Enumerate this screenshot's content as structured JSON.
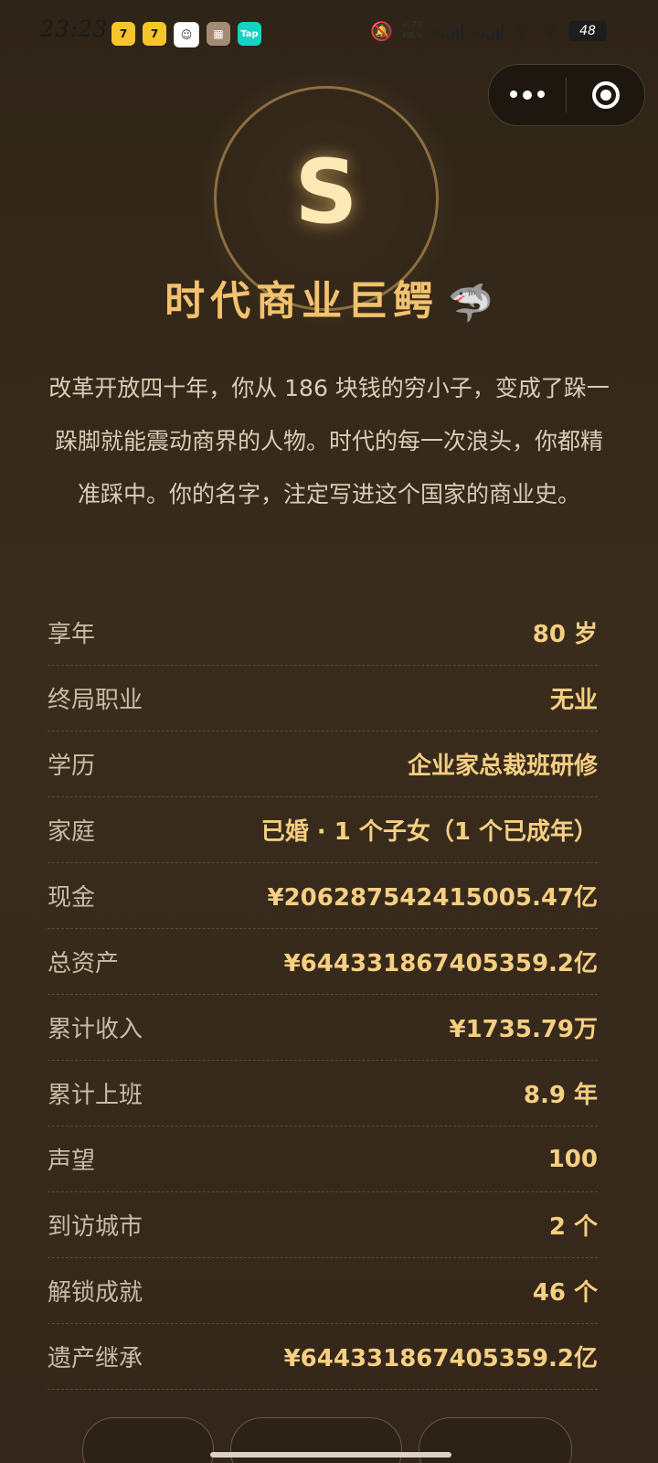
{
  "status_bar": {
    "time": "23:23",
    "net_speed_value": "4.70",
    "net_speed_unit": "KB/s",
    "signal_1": "5G",
    "signal_2": "5G",
    "battery": "48",
    "notification_icons": [
      "qimao-icon",
      "qimao-icon",
      "avatar-icon",
      "photo-icon",
      "taptap-icon"
    ],
    "taptap_label": "Tap"
  },
  "result": {
    "grade": "S",
    "title": "时代商业巨鳄",
    "title_emoji": "🦈",
    "description": "改革开放四十年，你从 186 块钱的穷小子，变成了跺一跺脚就能震动商界的人物。时代的每一次浪头，你都精准踩中。你的名字，注定写进这个国家的商业史。"
  },
  "stats": [
    {
      "label": "享年",
      "value": "80 岁"
    },
    {
      "label": "终局职业",
      "value": "无业"
    },
    {
      "label": "学历",
      "value": "企业家总裁班研修"
    },
    {
      "label": "家庭",
      "value": "已婚 · 1 个子女（1 个已成年）"
    },
    {
      "label": "现金",
      "value": "¥206287542415005.47亿"
    },
    {
      "label": "总资产",
      "value": "¥644331867405359.2亿"
    },
    {
      "label": "累计收入",
      "value": "¥1735.79万"
    },
    {
      "label": "累计上班",
      "value": "8.9 年"
    },
    {
      "label": "声望",
      "value": "100"
    },
    {
      "label": "到访城市",
      "value": "2 个"
    },
    {
      "label": "解锁成就",
      "value": "46 个"
    },
    {
      "label": "遗产继承",
      "value": "¥644331867405359.2亿"
    }
  ],
  "colors": {
    "background": "#2e2417",
    "accent_gold": "#f2c26d",
    "value_gold": "#f5cf82"
  }
}
